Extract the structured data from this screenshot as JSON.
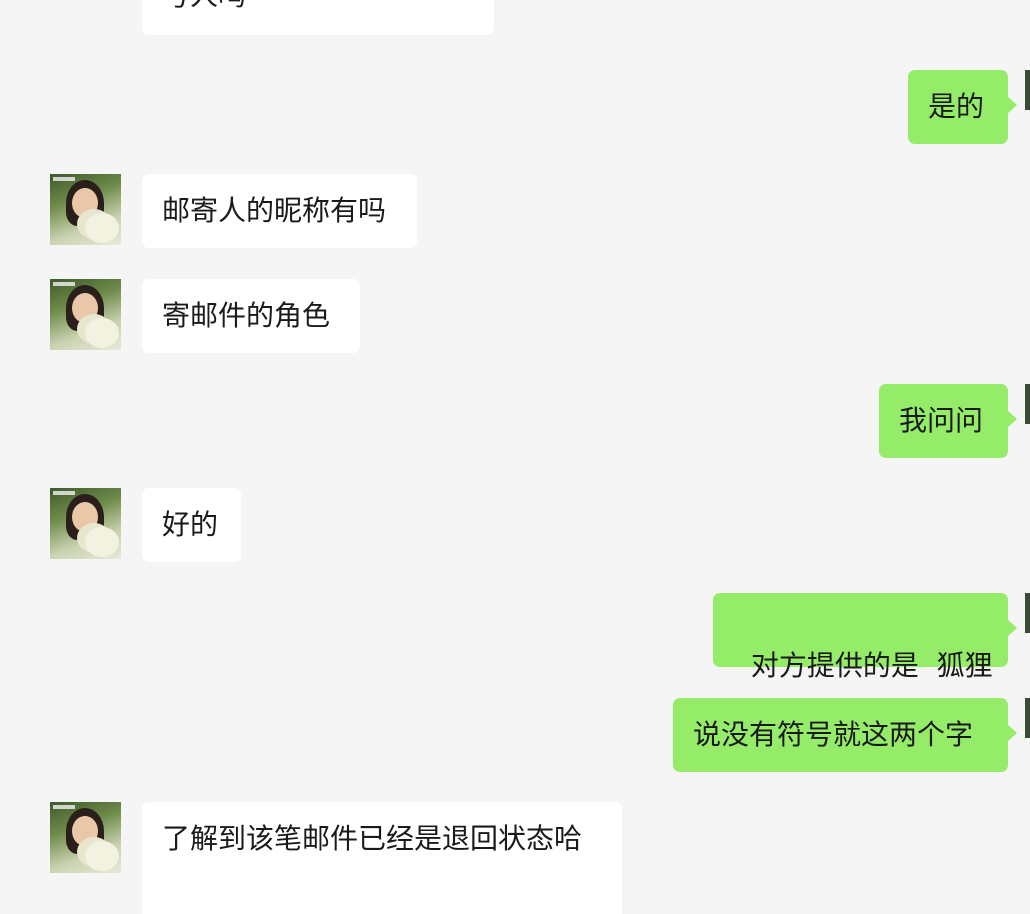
{
  "messages": [
    {
      "side": "in",
      "text": "号人吗"
    },
    {
      "side": "out",
      "text": "是的"
    },
    {
      "side": "in",
      "text": "邮寄人的昵称有吗"
    },
    {
      "side": "in",
      "text": "寄邮件的角色"
    },
    {
      "side": "out",
      "text": "我问问"
    },
    {
      "side": "in",
      "text": "好的"
    },
    {
      "side": "out",
      "text": "对方提供的是  狐狸"
    },
    {
      "side": "out",
      "text": "说没有符号就这两个字"
    },
    {
      "side": "in",
      "text": "了解到该笔邮件已经是退回状态哈"
    }
  ],
  "colors": {
    "background": "#f5f5f5",
    "incoming_bubble": "#ffffff",
    "outgoing_bubble": "#95ec69"
  }
}
